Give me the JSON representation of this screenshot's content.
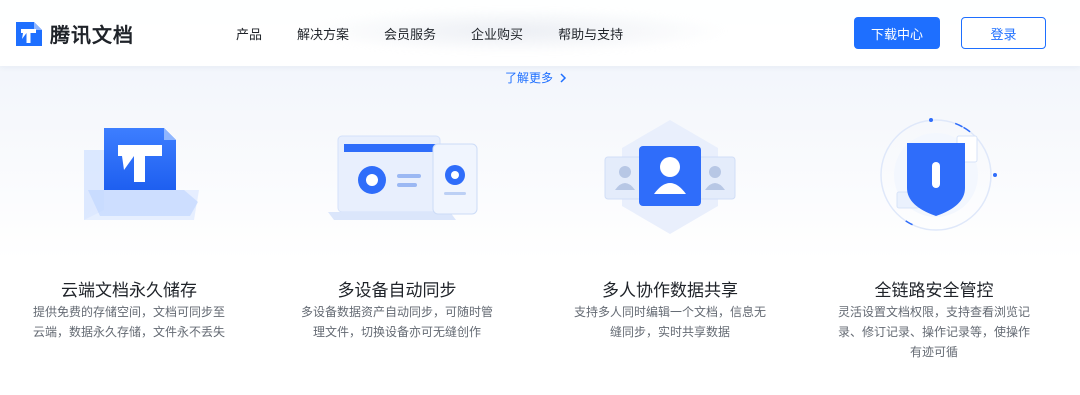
{
  "header": {
    "logo_text": "腾讯文档",
    "nav": [
      "产品",
      "解决方案",
      "会员服务",
      "企业购买",
      "帮助与支持"
    ],
    "download_label": "下载中心",
    "login_label": "登录"
  },
  "hero": {
    "learn_more": "了解更多"
  },
  "features": [
    {
      "icon": "document-laptop-icon",
      "title": "云端文档永久储存",
      "desc": "提供免费的存储空间，文档可同步至云端，数据永久存储，文件永不丢失"
    },
    {
      "icon": "multi-device-sync-icon",
      "title": "多设备自动同步",
      "desc": "多设备数据资产自动同步，可随时管理文件，切换设备亦可无缝创作"
    },
    {
      "icon": "collaboration-users-icon",
      "title": "多人协作数据共享",
      "desc": "支持多人同时编辑一个文档，信息无缝同步，实时共享数据"
    },
    {
      "icon": "security-shield-icon",
      "title": "全链路安全管控",
      "desc": "灵活设置文档权限，支持查看浏览记录、修订记录、操作记录等，使操作有迹可循"
    }
  ],
  "colors": {
    "accent": "#1e6fff",
    "text": "#1f2329",
    "muted": "#646a73"
  }
}
